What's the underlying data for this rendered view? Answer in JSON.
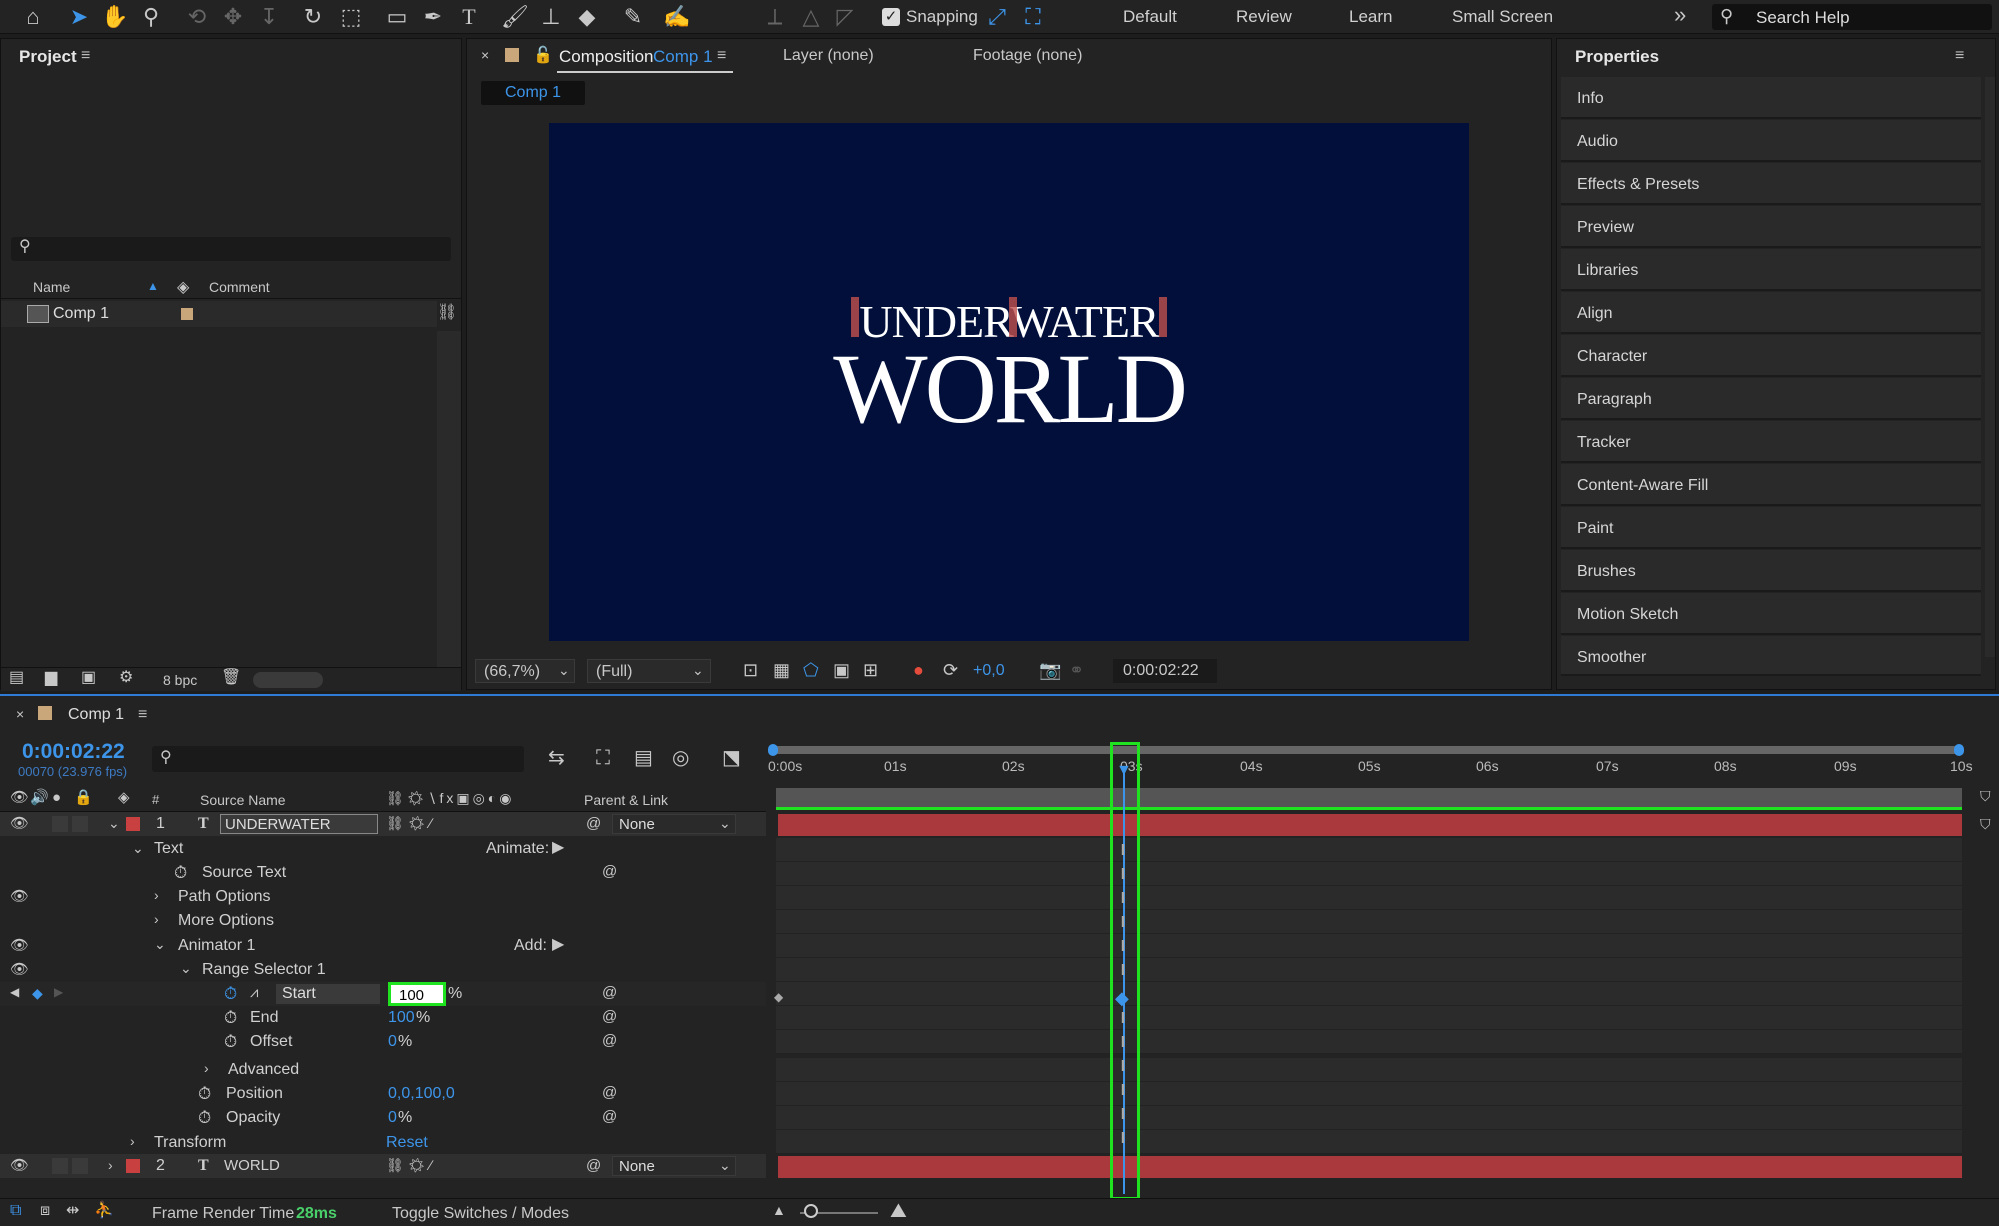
{
  "toolbar": {
    "snapping_label": "Snapping",
    "workspaces": [
      "Default",
      "Review",
      "Learn",
      "Small Screen"
    ],
    "search_placeholder": "Search Help"
  },
  "project": {
    "title": "Project",
    "col_name": "Name",
    "col_comment": "Comment",
    "item": "Comp 1",
    "bpc": "8 bpc"
  },
  "viewer": {
    "tab_title": "Composition",
    "tab_comp": "Comp 1",
    "layer_tab": "Layer (none)",
    "footage_tab": "Footage (none)",
    "crumb": "Comp 1",
    "text_line1": "UNDERWATER",
    "text_line2": "WORLD",
    "zoom": "(66,7%)",
    "resolution": "(Full)",
    "exposure": "+0,0",
    "timecode": "0:00:02:22",
    "bg_color": "#010f3a"
  },
  "properties": {
    "title": "Properties",
    "items": [
      "Info",
      "Audio",
      "Effects & Presets",
      "Preview",
      "Libraries",
      "Align",
      "Character",
      "Paragraph",
      "Tracker",
      "Content-Aware Fill",
      "Paint",
      "Brushes",
      "Motion Sketch",
      "Smoother"
    ]
  },
  "timeline": {
    "comp_tab": "Comp 1",
    "timecode": "0:00:02:22",
    "fps": "00070 (23.976 fps)",
    "col_num": "#",
    "col_source": "Source Name",
    "col_parent": "Parent & Link",
    "layer1": {
      "num": "1",
      "name": "UNDERWATER",
      "parent": "None"
    },
    "layer2": {
      "num": "2",
      "name": "WORLD",
      "parent": "None"
    },
    "text": "Text",
    "animate": "Animate:",
    "source_text": "Source Text",
    "path_options": "Path Options",
    "more_options": "More Options",
    "animator": "Animator 1",
    "add": "Add:",
    "range_selector": "Range Selector 1",
    "start_label": "Start",
    "start_value": "100",
    "start_unit": "%",
    "end_label": "End",
    "end_value": "100",
    "end_unit": "%",
    "offset_label": "Offset",
    "offset_value": "0",
    "offset_unit": "%",
    "advanced": "Advanced",
    "position_label": "Position",
    "position_value": "0,0,100,0",
    "opacity_label": "Opacity",
    "opacity_value": "0",
    "opacity_unit": "%",
    "transform": "Transform",
    "reset": "Reset",
    "ruler": [
      "0:00s",
      "01s",
      "02s",
      "03s",
      "04s",
      "05s",
      "06s",
      "07s",
      "08s",
      "09s",
      "10s"
    ],
    "frame_render_label": "Frame Render Time",
    "frame_render_value": "28ms",
    "toggle": "Toggle Switches / Modes"
  }
}
